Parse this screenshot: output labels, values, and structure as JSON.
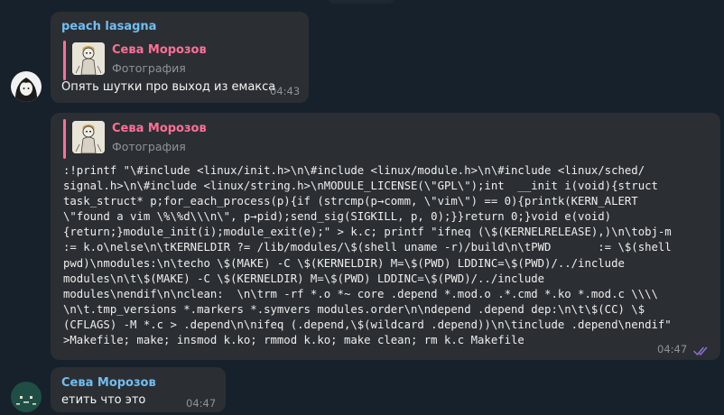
{
  "messages": [
    {
      "sender": "peach lasagna",
      "reply": {
        "name": "Сева Морозов",
        "subtitle": "Фотография"
      },
      "text": "Опять шутки про выход из емакса",
      "time": "04:43"
    },
    {
      "reply": {
        "name": "Сева Морозов",
        "subtitle": "Фотография"
      },
      "code": [
        ":!printf \"\\#include <linux/init.h>\\n\\#include <linux/module.h>\\n\\#include <linux/sched/",
        "signal.h>\\n\\#include <linux/string.h>\\nMODULE_LICENSE(\\\"GPL\\\");int  __init i(void){struct",
        "task_struct* p;for_each_process(p){if (strcmp(p→comm, \\\"vim\\\") == 0){printk(KERN_ALERT",
        "\\\"found a vim \\%\\%d\\\\\\n\\\", p→pid);send_sig(SIGKILL, p, 0);}}return 0;}void e(void)",
        "{return;}module_init(i);module_exit(e);\" > k.c; printf \"ifneq (\\$(KERNELRELEASE),)\\n\\tobj-m",
        ":= k.o\\nelse\\n\\tKERNELDIR ?= /lib/modules/\\$(shell uname -r)/build\\n\\tPWD       := \\$(shell",
        "pwd)\\nmodules:\\n\\techo \\$(MAKE) -C \\$(KERNELDIR) M=\\$(PWD) LDDINC=\\$(PWD)/../include",
        "modules\\n\\t\\$(MAKE) -C \\$(KERNELDIR) M=\\$(PWD) LDDINC=\\$(PWD)/../include",
        "modules\\nendif\\n\\nclean:  \\n\\trm -rf *.o *~ core .depend *.mod.o .*.cmd *.ko *.mod.c \\\\\\\\",
        "\\n\\t.tmp_versions *.markers *.symvers modules.order\\n\\ndepend .depend dep:\\n\\t\\$(CC) \\$",
        "(CFLAGS) -M *.c > .depend\\n\\nifeq (.depend,\\$(wildcard .depend))\\n\\tinclude .depend\\nendif\"",
        ">Makefile; make; insmod k.ko; rmmod k.ko; make clean; rm k.c Makefile"
      ],
      "time": "04:47"
    },
    {
      "sender": "Сева Морозов",
      "text": "етить что это",
      "time": "04:47"
    }
  ],
  "icons": {
    "read_receipt": "double-check-icon"
  },
  "colors": {
    "background": "#17212b",
    "bubble": "#2b2f33",
    "sender_name": "#72bdf0",
    "reply_accent": "#ff6f96",
    "timestamp": "#8d9399",
    "read_check": "#8c6fd8"
  }
}
